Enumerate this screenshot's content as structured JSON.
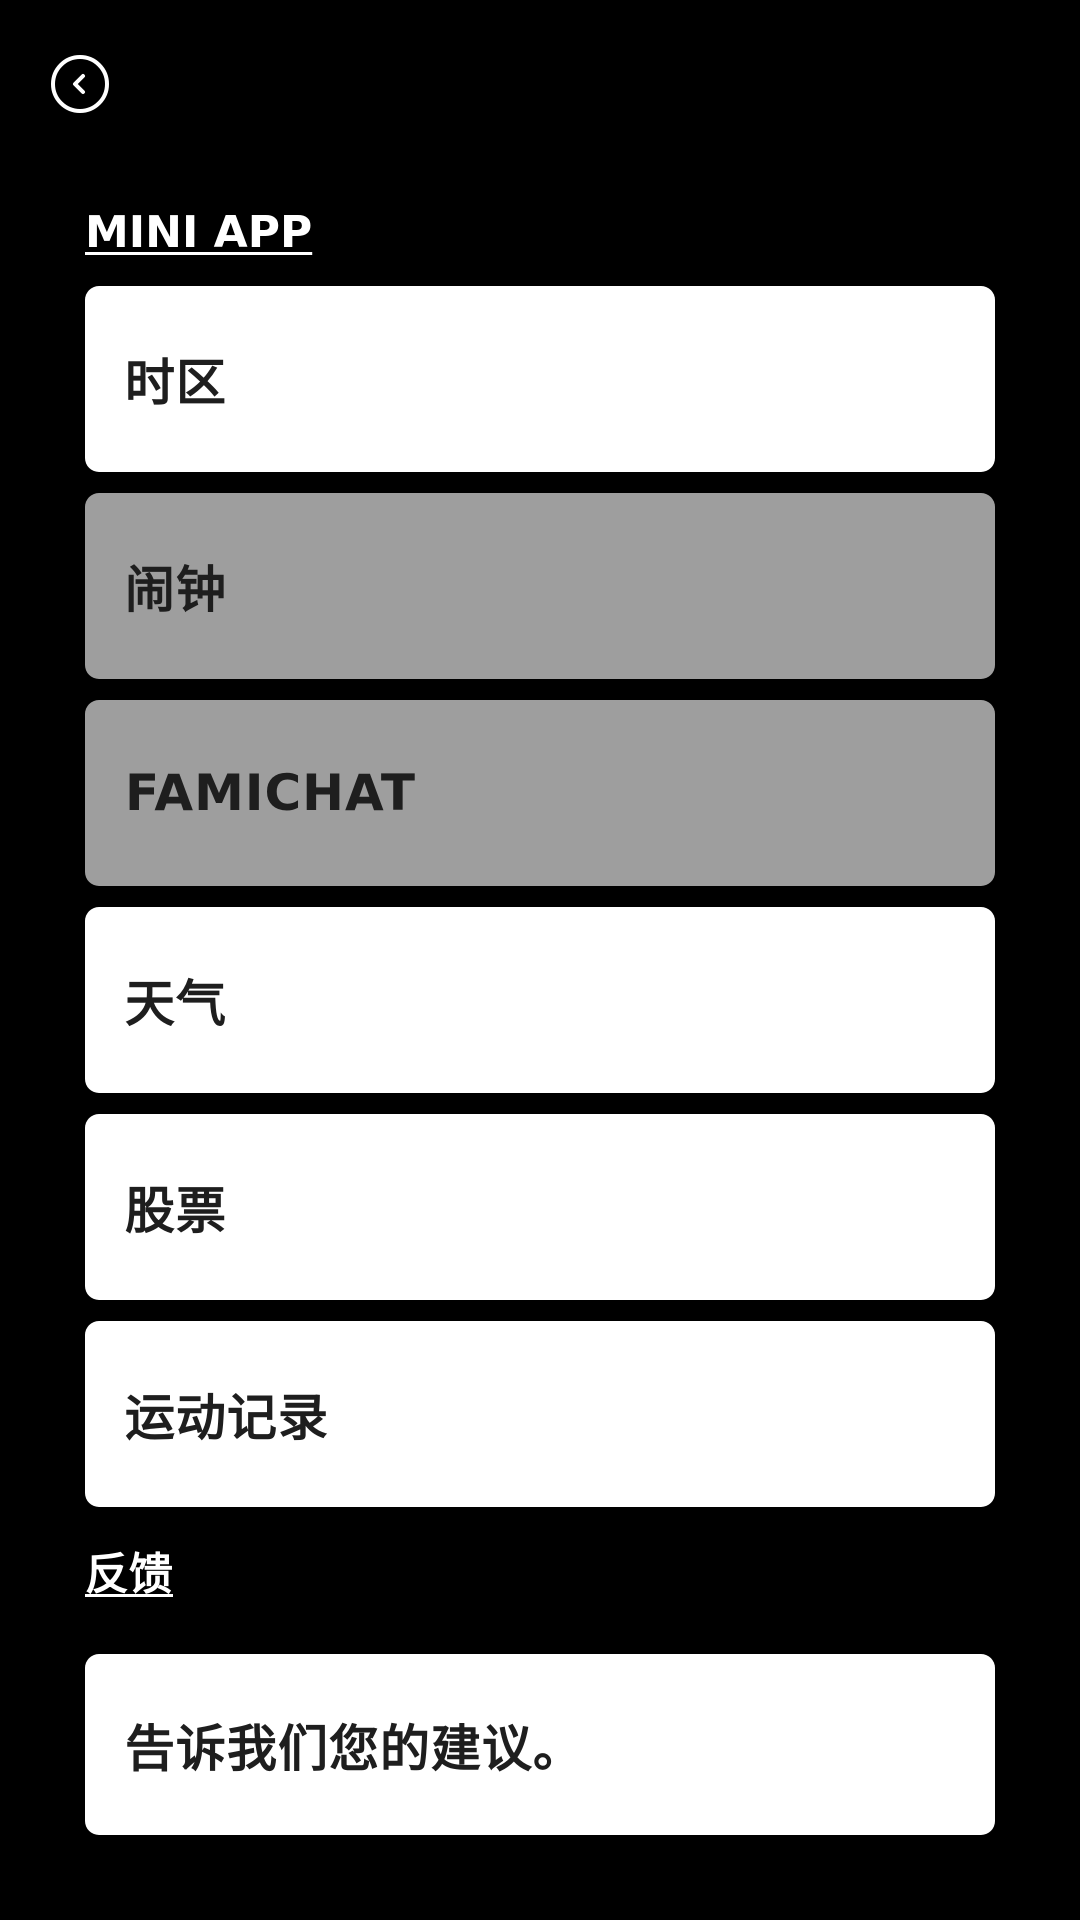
{
  "header": {
    "back_icon": "chevron-left-circle-icon"
  },
  "mini_app": {
    "title": "MINI APP",
    "items": [
      {
        "label": "时区",
        "enabled": true
      },
      {
        "label": "闹钟",
        "enabled": false
      },
      {
        "label": "FAMICHAT",
        "enabled": false
      },
      {
        "label": "天气",
        "enabled": true
      },
      {
        "label": "股票",
        "enabled": true
      },
      {
        "label": "运动记录",
        "enabled": true
      }
    ]
  },
  "feedback": {
    "title": "反馈",
    "prompt": "告诉我们您的建议。"
  },
  "colors": {
    "background": "#000000",
    "card_enabled": "#ffffff",
    "card_disabled": "#9e9e9e",
    "card_text": "#1e1e1e",
    "heading_text": "#ffffff"
  }
}
